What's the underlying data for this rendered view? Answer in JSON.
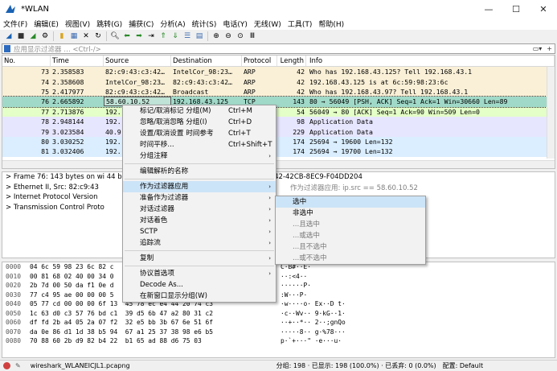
{
  "window": {
    "title": "*WLAN",
    "minimize": "—",
    "maximize": "☐",
    "close": "✕"
  },
  "menubar": [
    "文件(F)",
    "编辑(E)",
    "视图(V)",
    "跳转(G)",
    "捕获(C)",
    "分析(A)",
    "统计(S)",
    "电话(Y)",
    "无线(W)",
    "工具(T)",
    "帮助(H)"
  ],
  "filter": {
    "placeholder": "应用显示过滤器 … <Ctrl-/>",
    "btn1": "▭▾",
    "btn2": "+"
  },
  "columns": [
    "No.",
    "Time",
    "Source",
    "Destination",
    "Protocol",
    "Length",
    "Info"
  ],
  "packets": [
    {
      "no": "73",
      "time": "2.358583",
      "src": "82:c9:43:c3:42…",
      "dst": "IntelCor_98:23…",
      "proto": "ARP",
      "len": "42",
      "info": "Who has 192.168.43.125? Tell 192.168.43.1",
      "bg": "#faf0d7"
    },
    {
      "no": "74",
      "time": "2.358608",
      "src": "IntelCor_98:23…",
      "dst": "82:c9:43:c3:42…",
      "proto": "ARP",
      "len": "42",
      "info": "192.168.43.125 is at 6c:59:98:23:6c",
      "bg": "#faf0d7"
    },
    {
      "no": "75",
      "time": "2.417977",
      "src": "82:c9:43:c3:42…",
      "dst": "Broadcast",
      "proto": "ARP",
      "len": "42",
      "info": "Who has 192.168.43.97? Tell 192.168.43.1",
      "bg": "#faf0d7"
    },
    {
      "no": "76",
      "time": "2.665892",
      "src": "58.60.10.52",
      "dst": "192.168.43.125",
      "proto": "TCP",
      "len": "143",
      "info": "80 → 56049 [PSH, ACK] Seq=1 Ack=1 Win=30660 Len=89",
      "bg": "#a0d9c8"
    },
    {
      "no": "77",
      "time": "2.713876",
      "src": "192.",
      "dst": "",
      "proto": "",
      "len": "54",
      "info": "56049 → 80 [ACK] Seq=1 Ack=90 Win=509 Len=0",
      "bg": "#e4ffc7"
    },
    {
      "no": "78",
      "time": "2.948144",
      "src": "192.",
      "dst": "",
      "proto": "",
      "len": "98",
      "info": "Application Data",
      "bg": "#e7e6ff"
    },
    {
      "no": "79",
      "time": "3.023584",
      "src": "40.9",
      "dst": "",
      "proto": "",
      "len": "229",
      "info": "Application Data",
      "bg": "#e7e6ff"
    },
    {
      "no": "80",
      "time": "3.030252",
      "src": "192.",
      "dst": "",
      "proto": "",
      "len": "174",
      "info": "25694 → 19600 Len=132",
      "bg": "#daeeff"
    },
    {
      "no": "81",
      "time": "3.032406",
      "src": "192.",
      "dst": "",
      "proto": "",
      "len": "174",
      "info": "25694 → 19700 Len=132",
      "bg": "#daeeff"
    }
  ],
  "details": [
    "> Frame 76: 143 bytes on wi                                    44 bits) on interface \\Device\\NPF_{1A8C3C09-6842-42CB-8EC9-F04DD204",
    "> Ethernet II, Src: 82:c9:43",
    "> Internet Protocol Version",
    "> Transmission Control Proto"
  ],
  "bytes": [
    {
      "off": "0000",
      "hex": "04 6c 59 98 23 6c 82 c",
      "asc": "C·B#··E·"
    },
    {
      "off": "0010",
      "hex": "00 81 68 02 40 00 34 0",
      "asc": "··:<4··"
    },
    {
      "off": "0020",
      "hex": "2b 7d 00 50 da f1 0e d",
      "asc": "······P·"
    },
    {
      "off": "0030",
      "hex": "77 c4 95 ae 00 00 00 5",
      "asc": ":W···P·"
    },
    {
      "off": "0040",
      "hex": "05 77 cd 00 00 00 6f 13  45 78 ec e4 44 20 74 c3",
      "asc": "·w····o· Ex··D t·"
    },
    {
      "off": "0050",
      "hex": "1c 63 d0 c3 57 76 bd c1  39 d5 6b 47 a2 80 31 c2",
      "asc": "·c··Wv·· 9·kG··1·"
    },
    {
      "off": "0060",
      "hex": "df fd 2b a4 05 2a 07 f2  32 e5 bb 3b 67 6e 51 6f",
      "asc": "··+··*·· 2··;gnQo"
    },
    {
      "off": "0070",
      "hex": "da 0e 86 d1 1d 38 b5 94  67 a1 25 37 38 98 e6 b5",
      "asc": "·····8·· g·%78···"
    },
    {
      "off": "0080",
      "hex": "70 88 60 2b d9 82 b4 22  b1 65 ad 88 d6 75 03",
      "asc": "p·`+···\" ·e···u·"
    }
  ],
  "status": {
    "file": "wireshark_WLANEICJL1.pcapng",
    "stats": "分组: 198 · 已显示: 198 (100.0%) · 已丢弃: 0 (0.0%)",
    "profile": "配置: Default"
  },
  "ctx": [
    {
      "t": "item",
      "label": "标记/取消标记 分组(M)",
      "sc": "Ctrl+M"
    },
    {
      "t": "item",
      "label": "忽略/取消忽略 分组(I)",
      "sc": "Ctrl+D"
    },
    {
      "t": "item",
      "label": "设置/取消设置 时间参考",
      "sc": "Ctrl+T"
    },
    {
      "t": "item",
      "label": "时间平移...",
      "sc": "Ctrl+Shift+T"
    },
    {
      "t": "item",
      "label": "分组注释",
      "ar": "›"
    },
    {
      "t": "sep"
    },
    {
      "t": "item",
      "label": "编辑解析的名称"
    },
    {
      "t": "sep"
    },
    {
      "t": "item",
      "label": "作为过滤器应用",
      "ar": "›",
      "hl": true
    },
    {
      "t": "item",
      "label": "准备作为过滤器",
      "ar": "›"
    },
    {
      "t": "item",
      "label": "对话过滤器",
      "ar": "›"
    },
    {
      "t": "item",
      "label": "对话着色",
      "ar": "›"
    },
    {
      "t": "item",
      "label": "SCTP",
      "ar": "›"
    },
    {
      "t": "item",
      "label": "追踪流",
      "ar": "›"
    },
    {
      "t": "sep"
    },
    {
      "t": "item",
      "label": "复制",
      "ar": "›"
    },
    {
      "t": "sep"
    },
    {
      "t": "item",
      "label": "协议首选项",
      "ar": "›"
    },
    {
      "t": "item",
      "label": "Decode As..."
    },
    {
      "t": "item",
      "label": "在新窗口显示分组(W)"
    }
  ],
  "submenu_hint": "作为过滤器应用: ip.src == 58.60.10.52",
  "submenu": [
    "选中",
    "非选中",
    "...且选中",
    "...或选中",
    "...且不选中",
    "...或不选中"
  ]
}
